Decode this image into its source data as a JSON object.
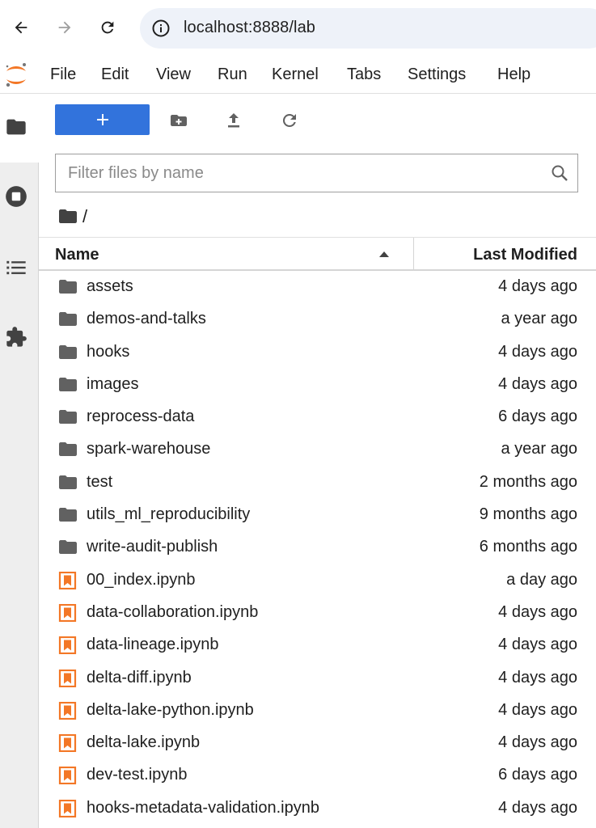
{
  "browser": {
    "url": "localhost:8888/lab",
    "icons": [
      "back-arrow-icon",
      "forward-arrow-icon",
      "reload-icon",
      "info-icon"
    ]
  },
  "menubar": {
    "items": [
      "File",
      "Edit",
      "View",
      "Run",
      "Kernel",
      "Tabs",
      "Settings",
      "Help"
    ]
  },
  "activity_bar": {
    "icons": [
      "folder-icon",
      "running-stop-icon",
      "table-of-contents-icon",
      "extension-puzzle-icon"
    ]
  },
  "filebrowser": {
    "new_button_label": "+",
    "filter_placeholder": "Filter files by name",
    "breadcrumb": "/",
    "columns": {
      "name": "Name",
      "modified": "Last Modified"
    },
    "sort": "ascending",
    "items": [
      {
        "type": "folder",
        "name": "assets",
        "modified": "4 days ago"
      },
      {
        "type": "folder",
        "name": "demos-and-talks",
        "modified": "a year ago"
      },
      {
        "type": "folder",
        "name": "hooks",
        "modified": "4 days ago"
      },
      {
        "type": "folder",
        "name": "images",
        "modified": "4 days ago"
      },
      {
        "type": "folder",
        "name": "reprocess-data",
        "modified": "6 days ago"
      },
      {
        "type": "folder",
        "name": "spark-warehouse",
        "modified": "a year ago"
      },
      {
        "type": "folder",
        "name": "test",
        "modified": "2 months ago"
      },
      {
        "type": "folder",
        "name": "utils_ml_reproducibility",
        "modified": "9 months ago"
      },
      {
        "type": "folder",
        "name": "write-audit-publish",
        "modified": "6 months ago"
      },
      {
        "type": "notebook",
        "name": "00_index.ipynb",
        "modified": "a day ago"
      },
      {
        "type": "notebook",
        "name": "data-collaboration.ipynb",
        "modified": "4 days ago"
      },
      {
        "type": "notebook",
        "name": "data-lineage.ipynb",
        "modified": "4 days ago"
      },
      {
        "type": "notebook",
        "name": "delta-diff.ipynb",
        "modified": "4 days ago"
      },
      {
        "type": "notebook",
        "name": "delta-lake-python.ipynb",
        "modified": "4 days ago"
      },
      {
        "type": "notebook",
        "name": "delta-lake.ipynb",
        "modified": "4 days ago"
      },
      {
        "type": "notebook",
        "name": "dev-test.ipynb",
        "modified": "6 days ago"
      },
      {
        "type": "notebook",
        "name": "hooks-metadata-validation.ipynb",
        "modified": "4 days ago"
      }
    ]
  },
  "colors": {
    "accent": "#3273dc",
    "jupyter_orange": "#f37726",
    "icon_gray": "#616161"
  }
}
